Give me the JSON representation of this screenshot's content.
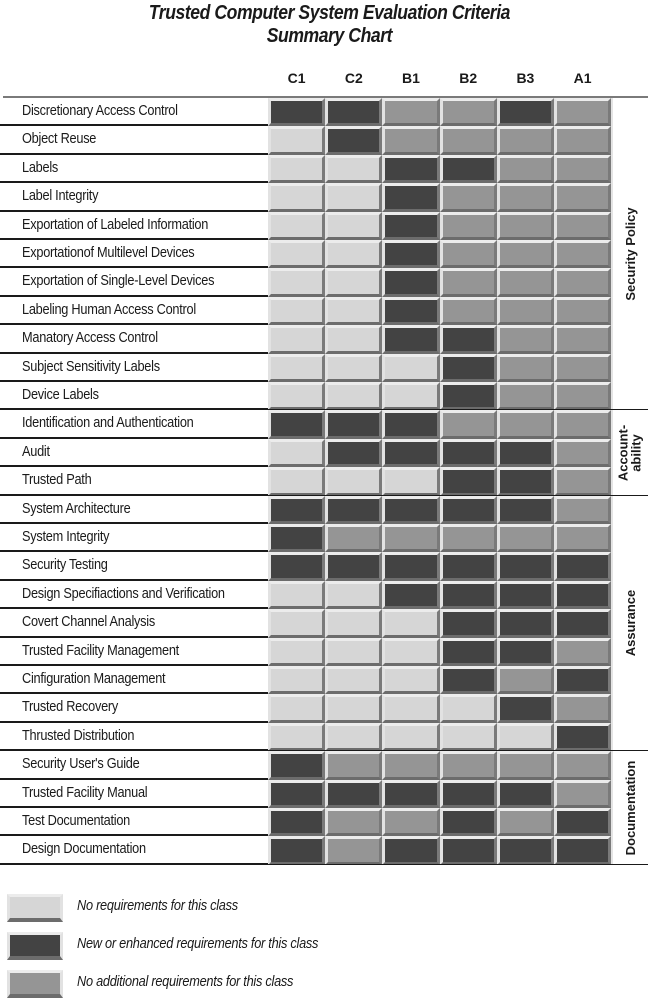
{
  "chart_data": {
    "type": "table",
    "title": "Trusted Computer System Evaluation Criteria",
    "subtitle": "Summary Chart",
    "columns": [
      "C1",
      "C2",
      "B1",
      "B2",
      "B3",
      "A1"
    ],
    "states": {
      "none": "No requirements for this class",
      "new": "New or enhanced requirements for this class",
      "noadd": "No additional requirements for this class"
    },
    "colors": {
      "none": "#d6d6d6",
      "new": "#434343",
      "noadd": "#959595"
    },
    "sections": [
      {
        "name": "Security Policy",
        "rows": [
          {
            "label": "Discretionary Access Control",
            "values": [
              "new",
              "new",
              "noadd",
              "noadd",
              "new",
              "noadd"
            ]
          },
          {
            "label": "Object Reuse",
            "values": [
              "none",
              "new",
              "noadd",
              "noadd",
              "noadd",
              "noadd"
            ]
          },
          {
            "label": "Labels",
            "values": [
              "none",
              "none",
              "new",
              "new",
              "noadd",
              "noadd"
            ]
          },
          {
            "label": "Label Integrity",
            "values": [
              "none",
              "none",
              "new",
              "noadd",
              "noadd",
              "noadd"
            ]
          },
          {
            "label": "Exportation of Labeled Information",
            "values": [
              "none",
              "none",
              "new",
              "noadd",
              "noadd",
              "noadd"
            ]
          },
          {
            "label": "Exportationof Multilevel Devices",
            "values": [
              "none",
              "none",
              "new",
              "noadd",
              "noadd",
              "noadd"
            ]
          },
          {
            "label": "Exportation of Single-Level Devices",
            "values": [
              "none",
              "none",
              "new",
              "noadd",
              "noadd",
              "noadd"
            ]
          },
          {
            "label": "Labeling Human Access Control",
            "values": [
              "none",
              "none",
              "new",
              "noadd",
              "noadd",
              "noadd"
            ]
          },
          {
            "label": "Manatory Access Control",
            "values": [
              "none",
              "none",
              "new",
              "new",
              "noadd",
              "noadd"
            ]
          },
          {
            "label": "Subject Sensitivity Labels",
            "values": [
              "none",
              "none",
              "none",
              "new",
              "noadd",
              "noadd"
            ]
          },
          {
            "label": "Device Labels",
            "values": [
              "none",
              "none",
              "none",
              "new",
              "noadd",
              "noadd"
            ]
          }
        ]
      },
      {
        "name": "Account-\nability",
        "name_lines": [
          "Account-",
          "ability"
        ],
        "rows": [
          {
            "label": "Identification and Authentication",
            "values": [
              "new",
              "new",
              "new",
              "noadd",
              "noadd",
              "noadd"
            ]
          },
          {
            "label": "Audit",
            "values": [
              "none",
              "new",
              "new",
              "new",
              "new",
              "noadd"
            ]
          },
          {
            "label": "Trusted Path",
            "values": [
              "none",
              "none",
              "none",
              "new",
              "new",
              "noadd"
            ]
          }
        ]
      },
      {
        "name": "Assurance",
        "rows": [
          {
            "label": "System Architecture",
            "values": [
              "new",
              "new",
              "new",
              "new",
              "new",
              "noadd"
            ]
          },
          {
            "label": "System Integrity",
            "values": [
              "new",
              "noadd",
              "noadd",
              "noadd",
              "noadd",
              "noadd"
            ]
          },
          {
            "label": "Security Testing",
            "values": [
              "new",
              "new",
              "new",
              "new",
              "new",
              "new"
            ]
          },
          {
            "label": "Design Specifiactions and Verification",
            "values": [
              "none",
              "none",
              "new",
              "new",
              "new",
              "new"
            ]
          },
          {
            "label": "Covert Channel Analysis",
            "values": [
              "none",
              "none",
              "none",
              "new",
              "new",
              "new"
            ]
          },
          {
            "label": "Trusted Facility Management",
            "values": [
              "none",
              "none",
              "none",
              "new",
              "new",
              "noadd"
            ]
          },
          {
            "label": "Cinfiguration Management",
            "values": [
              "none",
              "none",
              "none",
              "new",
              "noadd",
              "new"
            ]
          },
          {
            "label": "Trusted Recovery",
            "values": [
              "none",
              "none",
              "none",
              "none",
              "new",
              "noadd"
            ]
          },
          {
            "label": "Thrusted Distribution",
            "values": [
              "none",
              "none",
              "none",
              "none",
              "none",
              "new"
            ]
          }
        ]
      },
      {
        "name": "Documentation",
        "rows": [
          {
            "label": "Security User's Guide",
            "values": [
              "new",
              "noadd",
              "noadd",
              "noadd",
              "noadd",
              "noadd"
            ]
          },
          {
            "label": "Trusted Facility Manual",
            "values": [
              "new",
              "new",
              "new",
              "new",
              "new",
              "noadd"
            ]
          },
          {
            "label": "Test Documentation",
            "values": [
              "new",
              "noadd",
              "noadd",
              "new",
              "noadd",
              "new"
            ]
          },
          {
            "label": "Design Documentation",
            "values": [
              "new",
              "noadd",
              "new",
              "new",
              "new",
              "new"
            ]
          }
        ]
      }
    ],
    "legend": [
      {
        "state": "none",
        "label": "No requirements for this class"
      },
      {
        "state": "new",
        "label": "New or enhanced requirements for this class"
      },
      {
        "state": "noadd",
        "label": "No additional requirements for this class"
      }
    ]
  }
}
